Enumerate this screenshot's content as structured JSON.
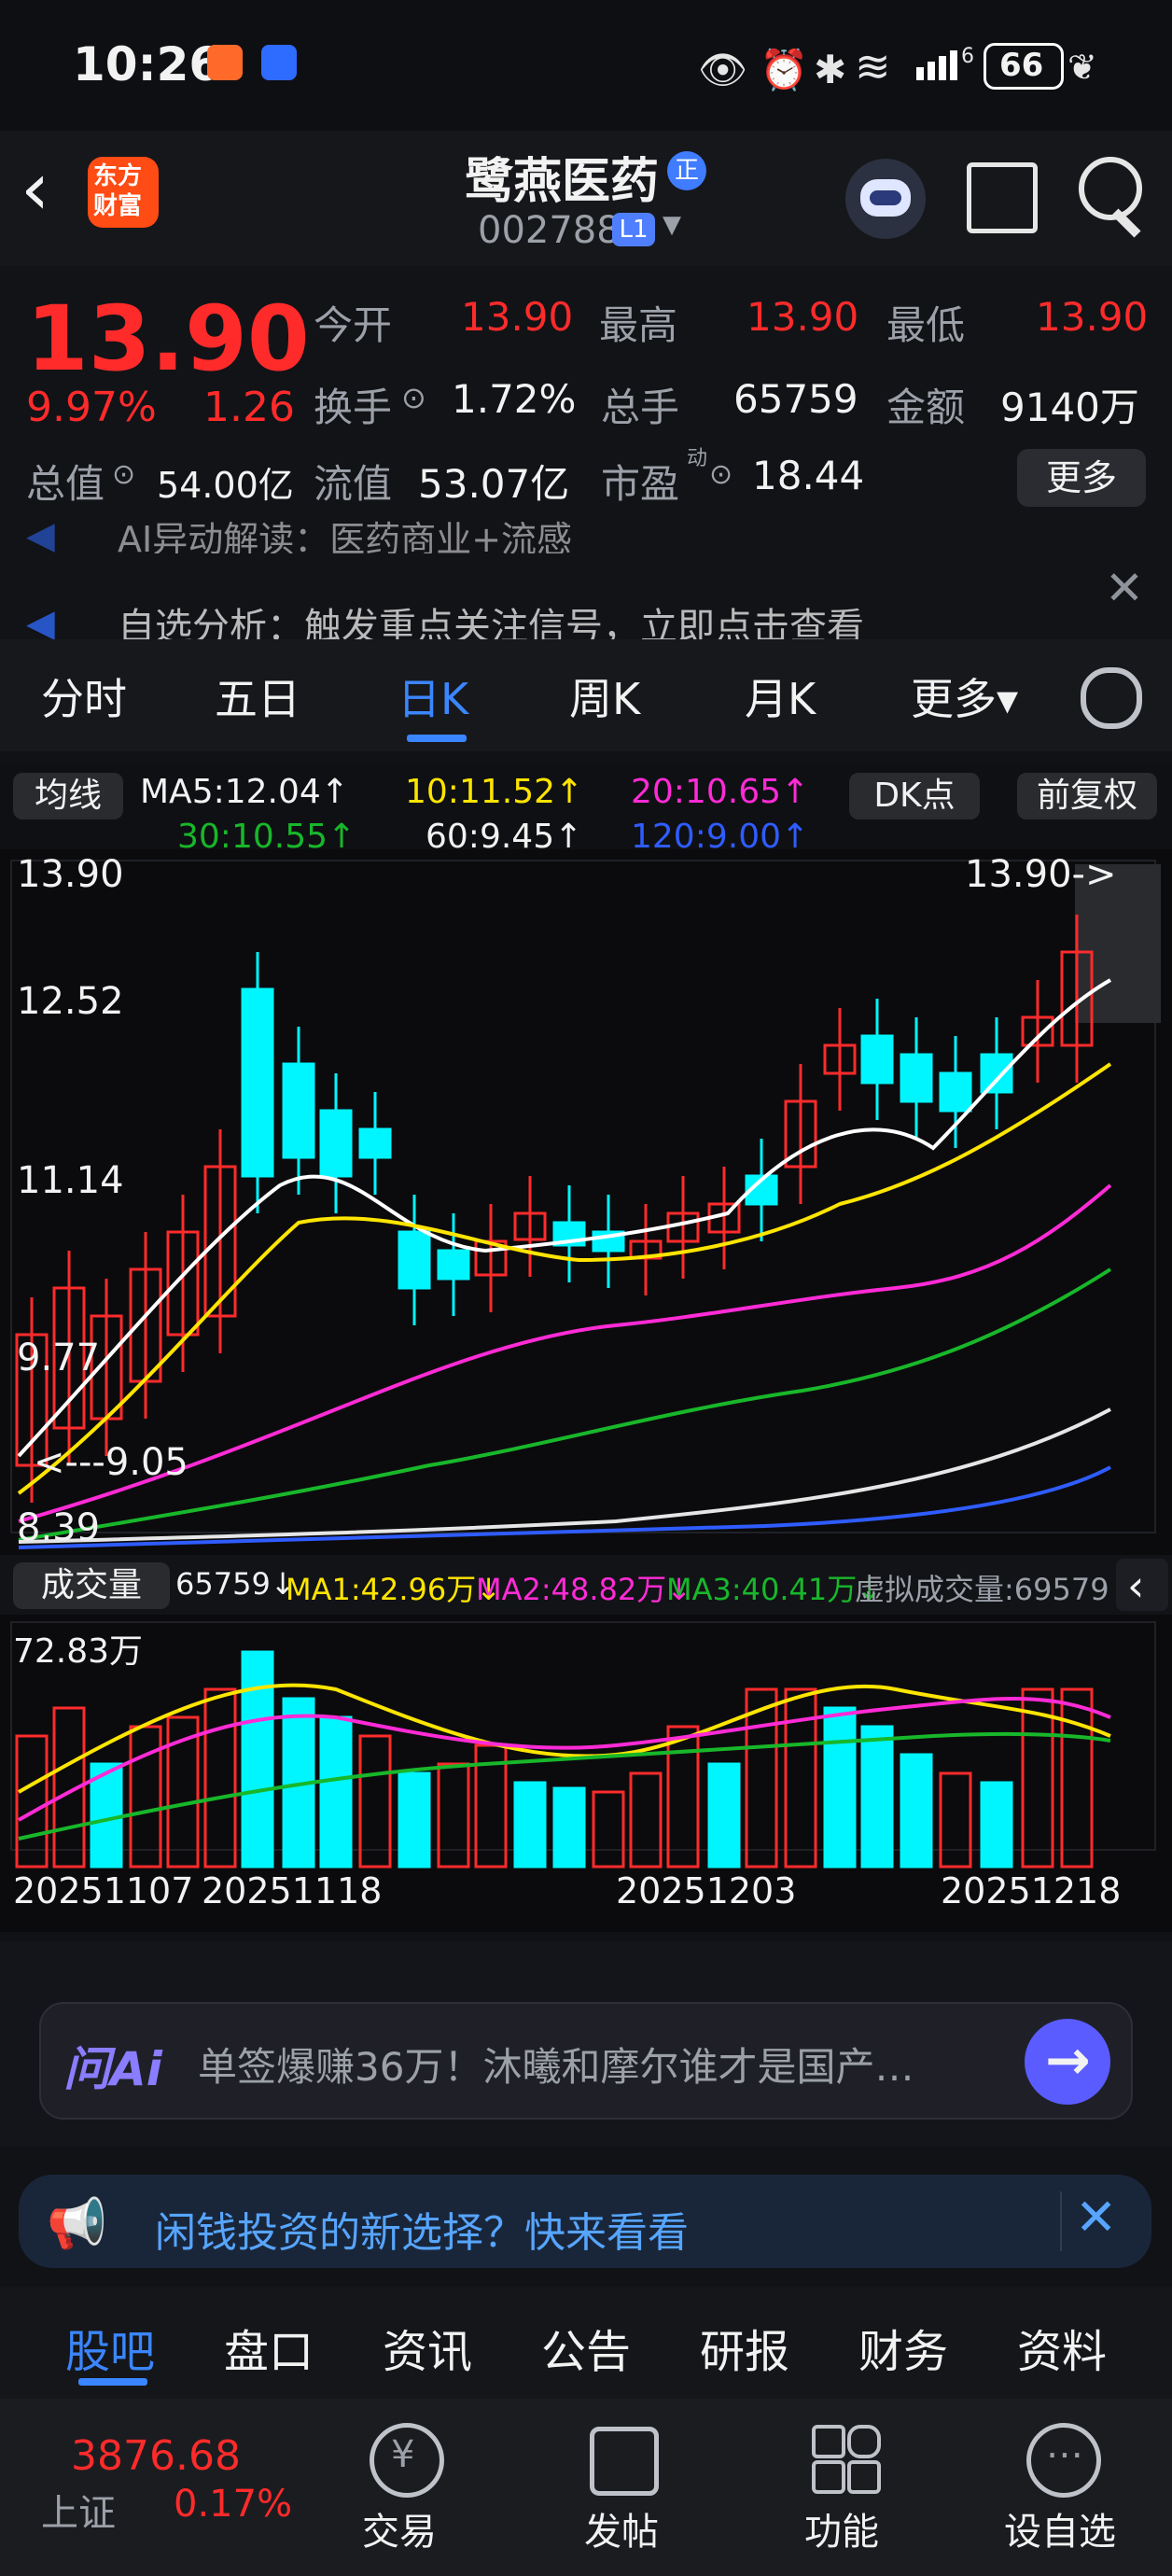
{
  "status": {
    "time": "10:26",
    "battery": "66",
    "signal_label": "6"
  },
  "header": {
    "logo_line1": "东方",
    "logo_line2": "财富",
    "stock_name": "鹭燕医药",
    "badge_zheng": "正",
    "stock_code": "002788",
    "level": "L1"
  },
  "quote": {
    "price": "13.90",
    "pct_change": "9.97%",
    "change": "1.26",
    "open_label": "今开",
    "open": "13.90",
    "high_label": "最高",
    "high": "13.90",
    "low_label": "最低",
    "low": "13.90",
    "turnover_label": "换手",
    "turnover": "1.72%",
    "volume_label": "总手",
    "volume": "65759",
    "amount_label": "金额",
    "amount": "9140万",
    "mktcap_label": "总值",
    "mktcap": "54.00亿",
    "float_label": "流值",
    "float": "53.07亿",
    "pe_label": "市盈",
    "pe_sup": "动",
    "pe": "18.44",
    "more": "更多"
  },
  "news": {
    "line1": "AI异动解读：医药商业+流感",
    "line2": "自选分析：触发重点关注信号，立即点击查看"
  },
  "tabs": {
    "items": [
      "分时",
      "五日",
      "日K",
      "周K",
      "月K",
      "更多▾"
    ],
    "active_index": 2
  },
  "ma": {
    "toggle": "均线",
    "ma5": "MA5:12.04↑",
    "ma10": "10:11.52↑",
    "ma20": "20:10.65↑",
    "ma30": "30:10.55↑",
    "ma60": "60:9.45↑",
    "ma120": "120:9.00↑",
    "dk": "DK点",
    "fuquan": "前复权"
  },
  "price_axis": {
    "labels": [
      "13.90",
      "12.52",
      "11.14",
      "9.77",
      "8.39"
    ],
    "top_marker": "13.90->",
    "low_marker": "<---9.05"
  },
  "volume_header": {
    "toggle": "成交量",
    "vol": "65759↓",
    "ma1": "MA1:42.96万↓",
    "ma2": "MA2:48.82万↓",
    "ma3": "MA3:40.41万↓",
    "virtual": "虚拟成交量:69579",
    "scale_label": "72.83万"
  },
  "x_axis": {
    "labels": [
      "20251107",
      "20251118",
      "20251203",
      "20251218"
    ]
  },
  "ai": {
    "brand": "问Ai",
    "text": "单签爆赚36万！沐曦和摩尔谁才是国产…"
  },
  "ad": {
    "text": "闲钱投资的新选择？快来看看"
  },
  "subtabs": {
    "items": [
      "股吧",
      "盘口",
      "资讯",
      "公告",
      "研报",
      "财务",
      "资料"
    ],
    "active_index": 0
  },
  "bottom": {
    "index_value": "3876.68",
    "index_name": "上证",
    "index_pct": "0.17%",
    "items": [
      "交易",
      "发帖",
      "功能",
      "设自选"
    ]
  },
  "colors": {
    "up": "#ff2b2b",
    "down": "#00f6ff",
    "ma5": "#ffffff",
    "ma10": "#ffe500",
    "ma20": "#ff2bd6",
    "ma30": "#18b72a",
    "ma60": "#e6e6e6",
    "ma120": "#2f5cff",
    "accent": "#3b86ff"
  }
}
